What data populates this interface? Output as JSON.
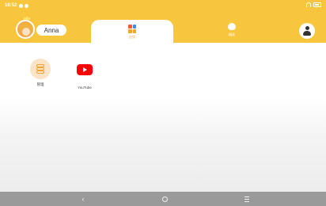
{
  "status_bar": {
    "time": "16:52",
    "icons_left": [
      "settings-icon",
      "notification-icon"
    ],
    "icons_right": [
      "wifi-icon",
      "battery-icon"
    ]
  },
  "header": {
    "profile_name": "Anna",
    "tabs": [
      {
        "label": "应用",
        "icon": "apps-icon",
        "active": true
      },
      {
        "label": "精选",
        "icon": "chat-bubble-icon",
        "active": false
      }
    ],
    "account_icon": "parent-account-icon"
  },
  "apps": [
    {
      "label": "管理",
      "icon": "layers-icon"
    },
    {
      "label": "YouTube",
      "icon": "youtube-icon"
    }
  ],
  "nav": {
    "buttons": [
      "back-icon",
      "home-icon",
      "recents-icon"
    ],
    "back_glyph": "‹"
  },
  "colors": {
    "header_bg": "#f7c63d",
    "accent": "#f2a431",
    "youtube_red": "#ff0000",
    "nav_bg": "#9a9a9a"
  }
}
